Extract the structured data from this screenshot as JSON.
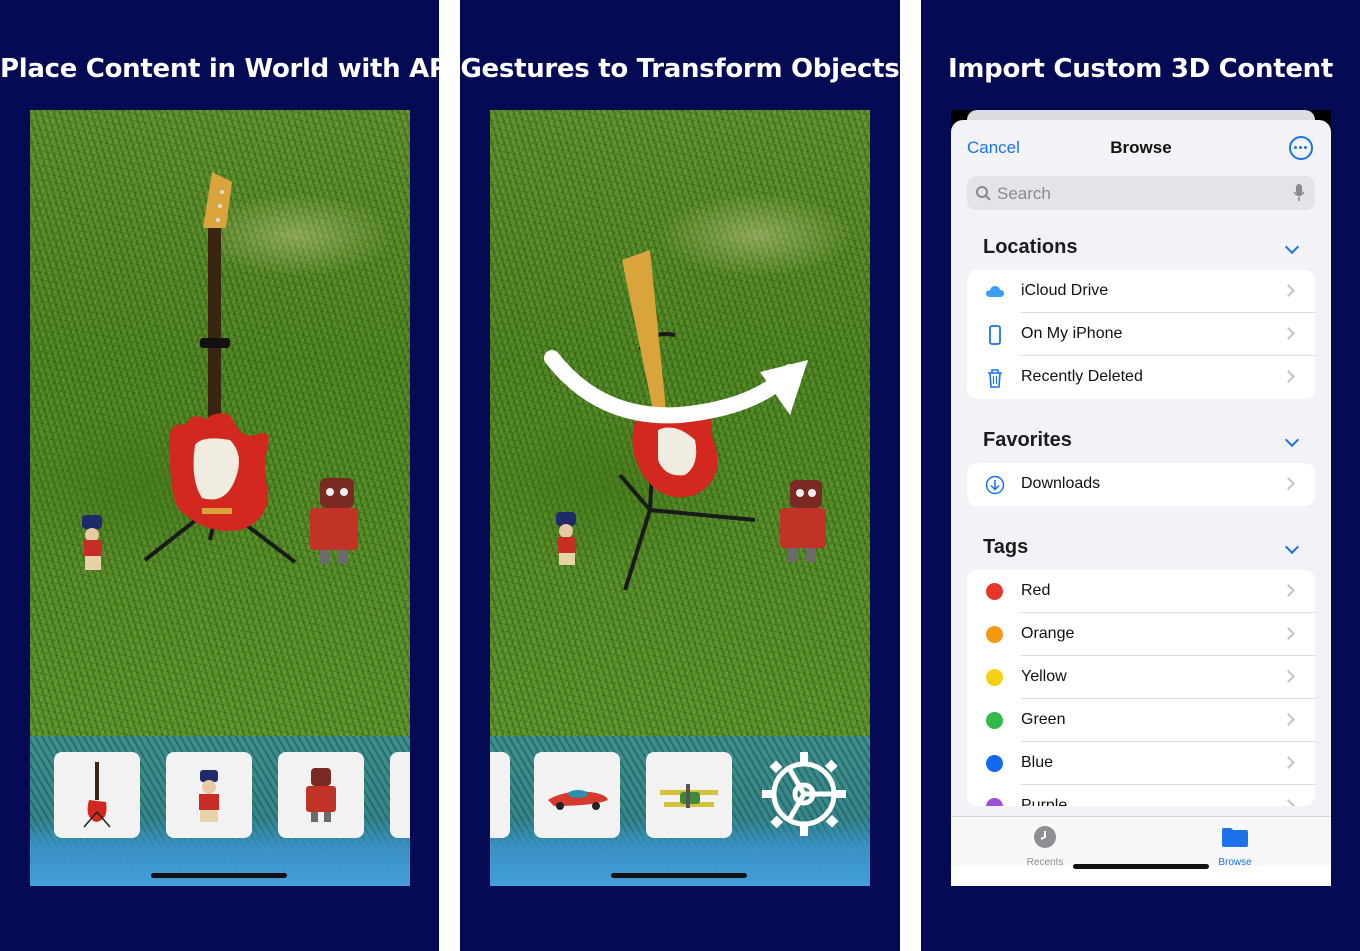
{
  "panels": [
    {
      "title": "Place Content in World with AR"
    },
    {
      "title": "Gestures to Transform Objects"
    },
    {
      "title": "Import Custom 3D Content"
    }
  ],
  "files": {
    "cancel": "Cancel",
    "title": "Browse",
    "search_placeholder": "Search",
    "locations": {
      "header": "Locations",
      "items": [
        {
          "label": "iCloud Drive",
          "icon": "icloud-icon"
        },
        {
          "label": "On My iPhone",
          "icon": "iphone-icon"
        },
        {
          "label": "Recently Deleted",
          "icon": "trash-icon"
        }
      ]
    },
    "favorites": {
      "header": "Favorites",
      "items": [
        {
          "label": "Downloads",
          "icon": "download-icon"
        }
      ]
    },
    "tags": {
      "header": "Tags",
      "items": [
        {
          "label": "Red",
          "color": "#e8352b"
        },
        {
          "label": "Orange",
          "color": "#f39a12"
        },
        {
          "label": "Yellow",
          "color": "#f7cf17"
        },
        {
          "label": "Green",
          "color": "#32b94a"
        },
        {
          "label": "Blue",
          "color": "#1269ee"
        },
        {
          "label": "Purple",
          "color": "#a04fd8"
        }
      ]
    },
    "tabs": [
      {
        "label": "Recents",
        "icon": "clock-icon",
        "active": false
      },
      {
        "label": "Browse",
        "icon": "folder-icon",
        "active": true
      }
    ],
    "accent": "#1a73e8"
  }
}
